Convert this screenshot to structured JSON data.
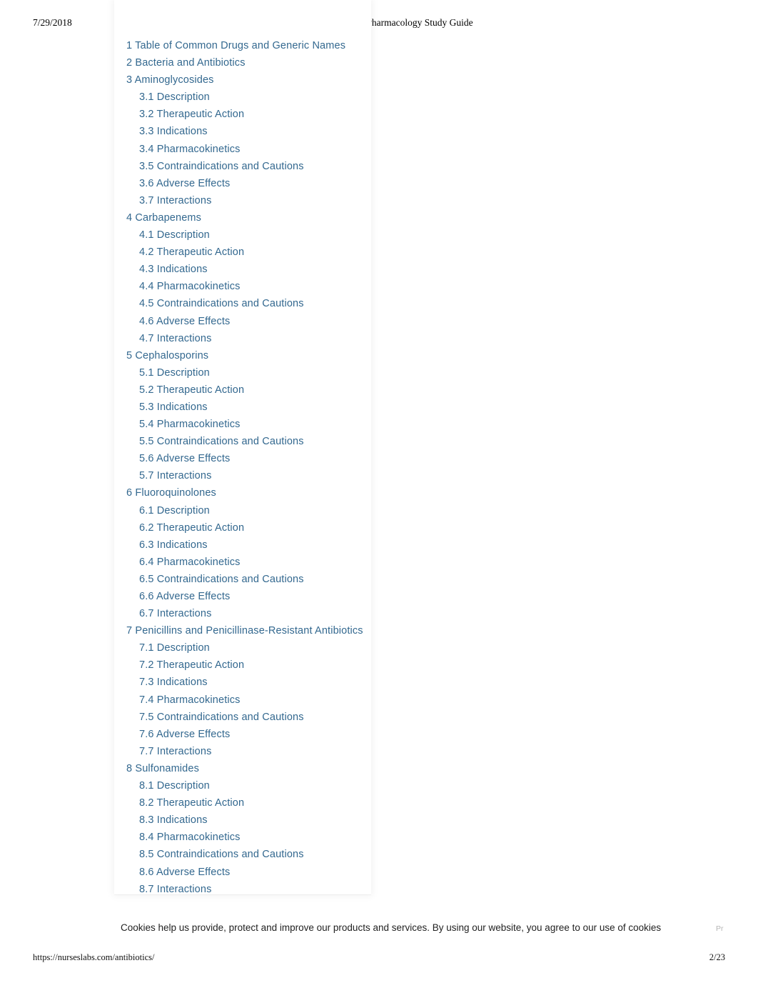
{
  "print_header": {
    "date": "7/29/2018",
    "title": "Antibiotics: Nursing Pharmacology Study Guide"
  },
  "toc": {
    "items": [
      {
        "label": "1 Table of Common Drugs and Generic Names",
        "level": 1
      },
      {
        "label": "2 Bacteria and Antibiotics",
        "level": 1
      },
      {
        "label": "3 Aminoglycosides",
        "level": 1
      },
      {
        "label": "3.1 Description",
        "level": 2
      },
      {
        "label": "3.2 Therapeutic Action",
        "level": 2
      },
      {
        "label": "3.3 Indications",
        "level": 2
      },
      {
        "label": "3.4 Pharmacokinetics",
        "level": 2
      },
      {
        "label": "3.5 Contraindications and Cautions",
        "level": 2
      },
      {
        "label": "3.6 Adverse Effects",
        "level": 2
      },
      {
        "label": "3.7 Interactions",
        "level": 2
      },
      {
        "label": "4 Carbapenems",
        "level": 1
      },
      {
        "label": "4.1 Description",
        "level": 2
      },
      {
        "label": "4.2 Therapeutic Action",
        "level": 2
      },
      {
        "label": "4.3 Indications",
        "level": 2
      },
      {
        "label": "4.4 Pharmacokinetics",
        "level": 2
      },
      {
        "label": "4.5 Contraindications and Cautions",
        "level": 2
      },
      {
        "label": "4.6 Adverse Effects",
        "level": 2
      },
      {
        "label": "4.7 Interactions",
        "level": 2
      },
      {
        "label": "5 Cephalosporins",
        "level": 1
      },
      {
        "label": "5.1 Description",
        "level": 2
      },
      {
        "label": "5.2 Therapeutic Action",
        "level": 2
      },
      {
        "label": "5.3 Indications",
        "level": 2
      },
      {
        "label": "5.4 Pharmacokinetics",
        "level": 2
      },
      {
        "label": "5.5 Contraindications and Cautions",
        "level": 2
      },
      {
        "label": "5.6 Adverse Effects",
        "level": 2
      },
      {
        "label": "5.7 Interactions",
        "level": 2
      },
      {
        "label": "6 Fluoroquinolones",
        "level": 1
      },
      {
        "label": "6.1 Description",
        "level": 2
      },
      {
        "label": "6.2 Therapeutic Action",
        "level": 2
      },
      {
        "label": "6.3 Indications",
        "level": 2
      },
      {
        "label": "6.4 Pharmacokinetics",
        "level": 2
      },
      {
        "label": "6.5 Contraindications and Cautions",
        "level": 2
      },
      {
        "label": "6.6 Adverse Effects",
        "level": 2
      },
      {
        "label": "6.7 Interactions",
        "level": 2
      },
      {
        "label": "7 Penicillins and Penicillinase-Resistant Antibiotics",
        "level": 1
      },
      {
        "label": "7.1 Description",
        "level": 2
      },
      {
        "label": "7.2 Therapeutic Action",
        "level": 2
      },
      {
        "label": "7.3 Indications",
        "level": 2
      },
      {
        "label": "7.4 Pharmacokinetics",
        "level": 2
      },
      {
        "label": "7.5 Contraindications and Cautions",
        "level": 2
      },
      {
        "label": "7.6 Adverse Effects",
        "level": 2
      },
      {
        "label": "7.7 Interactions",
        "level": 2
      },
      {
        "label": "8 Sulfonamides",
        "level": 1
      },
      {
        "label": "8.1 Description",
        "level": 2
      },
      {
        "label": "8.2 Therapeutic Action",
        "level": 2
      },
      {
        "label": "8.3 Indications",
        "level": 2
      },
      {
        "label": "8.4 Pharmacokinetics",
        "level": 2
      },
      {
        "label": "8.5 Contraindications and Cautions",
        "level": 2
      },
      {
        "label": "8.6 Adverse Effects",
        "level": 2
      },
      {
        "label": "8.7 Interactions",
        "level": 2
      }
    ],
    "link_color": "#33688f"
  },
  "cookie_notice": {
    "message": "Cookies help us provide, protect and improve our products and services. By using our website, you agree to our use of cookies",
    "link_label": "Pr"
  },
  "print_footer": {
    "url": "https://nurseslabs.com/antibiotics/",
    "page": "2/23"
  }
}
